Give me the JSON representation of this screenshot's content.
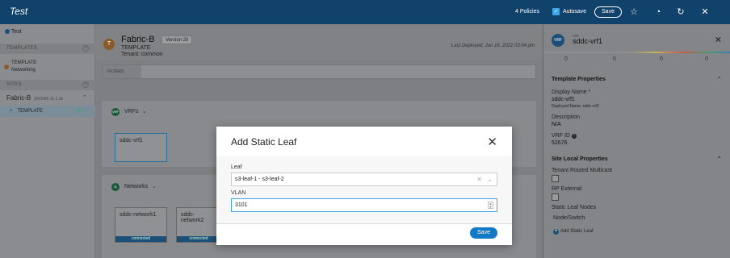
{
  "topbar": {
    "title": "Test",
    "policies": "4 Policies",
    "autosave_label": "Autosave",
    "save_label": "Save"
  },
  "sidebar": {
    "root_label": "Test",
    "templates_header": "TEMPLATES",
    "template_item": "TEMPLATE",
    "template_sub": "Networking",
    "sites_header": "SITES",
    "site_name": "Fabric-B",
    "site_meta": "(DCNM)  11.1.1e",
    "site_template": "TEMPLATE"
  },
  "main": {
    "avatar_letter": "T",
    "fabric_name": "Fabric-B",
    "version": "Version 20",
    "template_label": "TEMPLATE",
    "tenant": "Tenant: common",
    "last_deployed": "Last Deployed: Jun 16, 2022 03:04 pm",
    "filters_label": "FILTERS",
    "vrfs_label": "VRFs",
    "vrf_icon": "VRF",
    "vrf_card": "sddc-vrf1",
    "networks_label": "Networks",
    "network_icon": "N",
    "network_cards": [
      {
        "name": "sddc-network1",
        "status": "connected"
      },
      {
        "name": "sddc-network2",
        "status": "connected"
      }
    ]
  },
  "right_panel": {
    "icon_text": "VRF",
    "small_label": "VRF",
    "name": "sddc-vrf1",
    "counts": [
      "0",
      "0",
      "0",
      "0"
    ],
    "template_properties": "Template Properties",
    "display_name_label": "Display Name *",
    "display_name_value": "sddc-vrf1",
    "deployed_name": "Deployed Name: sddc-vrf1",
    "description_label": "Description",
    "description_value": "N/A",
    "vrf_id_label": "VRF ID",
    "vrf_id_value": "52676",
    "site_local_properties": "Site Local Properties",
    "tenant_routed_multicast": "Tenant Routed Multicast",
    "rp_external": "RP External",
    "static_leaf_nodes": "Static Leaf Nodes",
    "node_switch": "Node/Switch",
    "add_static_leaf": "Add Static Leaf"
  },
  "modal": {
    "title": "Add Static Leaf",
    "leaf_label": "Leaf",
    "leaf_value": "s3-leaf-1 - s3-leaf-2",
    "vlan_label": "VLAN",
    "vlan_value": "3101",
    "save_label": "Save"
  }
}
